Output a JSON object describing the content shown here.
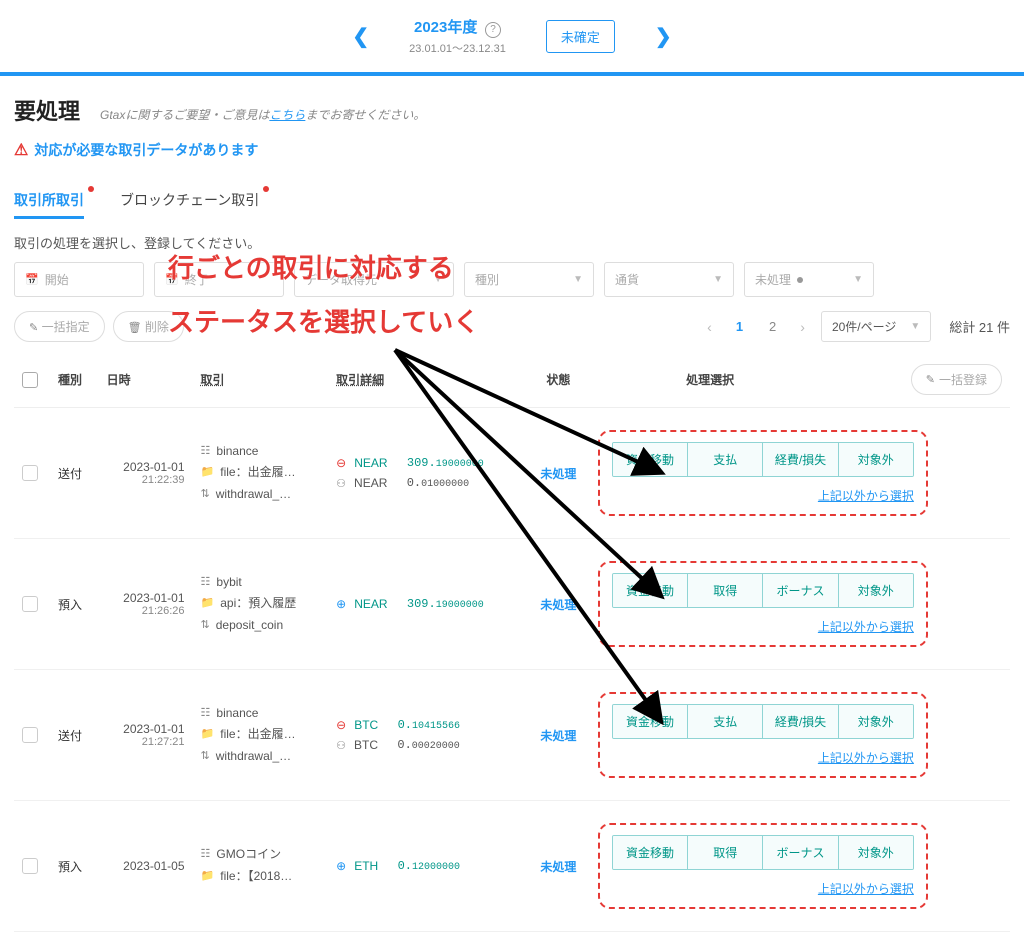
{
  "header": {
    "year_label": "2023年度",
    "year_range": "23.01.01～23.12.31",
    "status_badge": "未確定"
  },
  "page": {
    "title": "要処理",
    "subtitle_prefix": "Gtaxに関するご要望・ご意見は",
    "subtitle_link": "こちら",
    "subtitle_suffix": "までお寄せください。",
    "alert": "対応が必要な取引データがあります"
  },
  "tabs": {
    "exchange": "取引所取引",
    "blockchain": "ブロックチェーン取引"
  },
  "instruction": "取引の処理を選択し、登録してください。",
  "filters": {
    "start": "開始",
    "end": "終了",
    "exchange": "データ取得元",
    "type": "種別",
    "currency": "通貨",
    "status": "未処理"
  },
  "actions": {
    "bulk_select": "一括指定",
    "delete": "削除",
    "bulk_register": "一括登録"
  },
  "pager": {
    "page1": "1",
    "page2": "2",
    "page_size": "20件/ページ",
    "total": "総計 21 件"
  },
  "columns": {
    "type": "種別",
    "datetime": "日時",
    "transaction": "取引",
    "detail": "取引詳細",
    "status": "状態",
    "process": "処理選択"
  },
  "choice_link": "上記以外から選択",
  "rows": [
    {
      "type": "送付",
      "date": "2023-01-01",
      "time": "21:22:39",
      "tx": {
        "exchange": "binance",
        "file": "file：出金履…",
        "method": "withdrawal_…"
      },
      "details": [
        {
          "dir": "out",
          "coin": "NEAR",
          "class": "green",
          "amt_int": "309.",
          "amt_frac": "19000000"
        },
        {
          "dir": "fee",
          "coin": "NEAR",
          "class": "",
          "amt_int": "0.",
          "amt_frac": "01000000"
        }
      ],
      "status": "未処理",
      "choices": [
        "資金移動",
        "支払",
        "経費/損失",
        "対象外"
      ]
    },
    {
      "type": "預入",
      "date": "2023-01-01",
      "time": "21:26:26",
      "tx": {
        "exchange": "bybit",
        "file": "api：預入履歴",
        "method": "deposit_coin"
      },
      "details": [
        {
          "dir": "in",
          "coin": "NEAR",
          "class": "green",
          "amt_int": "309.",
          "amt_frac": "19000000"
        }
      ],
      "status": "未処理",
      "choices": [
        "資金移動",
        "取得",
        "ボーナス",
        "対象外"
      ]
    },
    {
      "type": "送付",
      "date": "2023-01-01",
      "time": "21:27:21",
      "tx": {
        "exchange": "binance",
        "file": "file：出金履…",
        "method": "withdrawal_…"
      },
      "details": [
        {
          "dir": "out",
          "coin": "BTC",
          "class": "green",
          "amt_int": "0.",
          "amt_frac": "10415566"
        },
        {
          "dir": "fee",
          "coin": "BTC",
          "class": "",
          "amt_int": "0.",
          "amt_frac": "00020000"
        }
      ],
      "status": "未処理",
      "choices": [
        "資金移動",
        "支払",
        "経費/損失",
        "対象外"
      ]
    },
    {
      "type": "預入",
      "date": "2023-01-05",
      "time": "",
      "tx": {
        "exchange": "GMOコイン",
        "file": "file：【2018…",
        "method": ""
      },
      "details": [
        {
          "dir": "in",
          "coin": "ETH",
          "class": "green",
          "amt_int": "0.",
          "amt_frac": "12000000"
        }
      ],
      "status": "未処理",
      "choices": [
        "資金移動",
        "取得",
        "ボーナス",
        "対象外"
      ]
    }
  ],
  "annotation": {
    "line1": "行ごとの取引に対応する",
    "line2": "ステータスを選択していく"
  }
}
